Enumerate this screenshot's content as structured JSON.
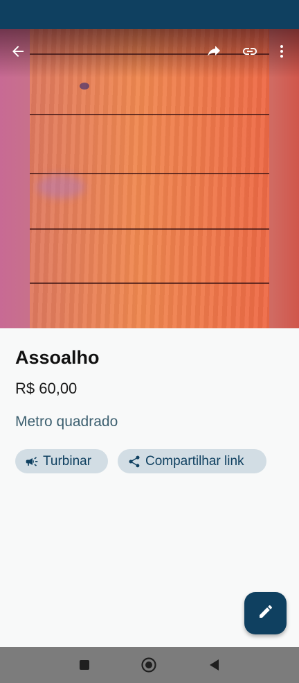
{
  "product": {
    "title": "Assoalho",
    "price": "R$ 60,00",
    "unit": "Metro quadrado"
  },
  "actions": {
    "boost_label": "Turbinar",
    "share_link_label": "Compartilhar link"
  },
  "toolbar": {
    "icons": [
      "arrow-back-icon",
      "share-icon",
      "link-icon",
      "more-vert-icon"
    ]
  },
  "fab": {
    "icon": "edit-icon"
  },
  "system_nav": {
    "icons": [
      "recents-icon",
      "home-icon",
      "back-icon"
    ]
  },
  "colors": {
    "primary": "#0f4060",
    "chip_background": "#d2dde4",
    "unit_text": "#3d6070",
    "nav_bar": "#7c7c7c"
  }
}
